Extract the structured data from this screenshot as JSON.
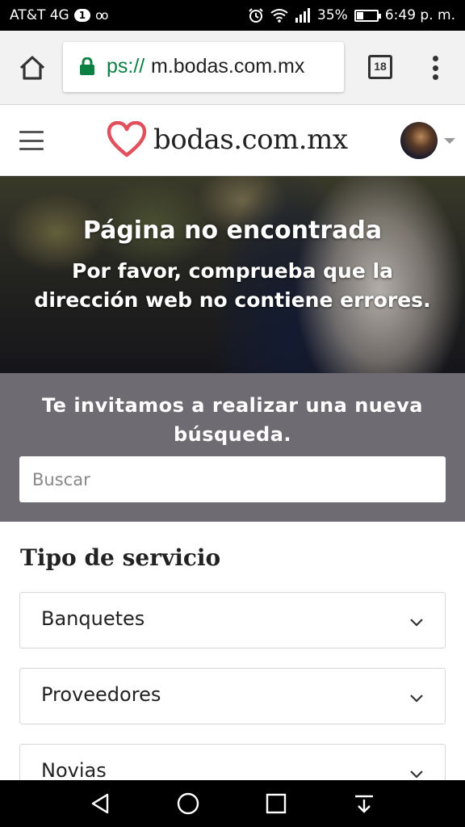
{
  "status_bar": {
    "carrier": "AT&T 4G",
    "sim_badge": "1",
    "voicemail_icon": "voicemail-icon",
    "battery_percent": "35%",
    "battery_level": 0.35,
    "time": "6:49 p. m."
  },
  "browser": {
    "url_scheme": "ps://",
    "url_host": "m.bodas.com.mx",
    "tab_count": "18",
    "secure_color": "#0b8043"
  },
  "header": {
    "logo_text": "bodas.com.mx",
    "brand_color": "#e0505d"
  },
  "hero": {
    "title": "Página no encontrada",
    "subtitle": "Por favor, comprueba que la dirección web no contiene errores."
  },
  "search": {
    "heading": "Te invitamos a realizar una nueva búsqueda.",
    "placeholder": "Buscar",
    "value": ""
  },
  "services": {
    "title": "Tipo de servicio",
    "items": [
      {
        "label": "Banquetes"
      },
      {
        "label": "Proveedores"
      },
      {
        "label": "Novias"
      }
    ]
  }
}
